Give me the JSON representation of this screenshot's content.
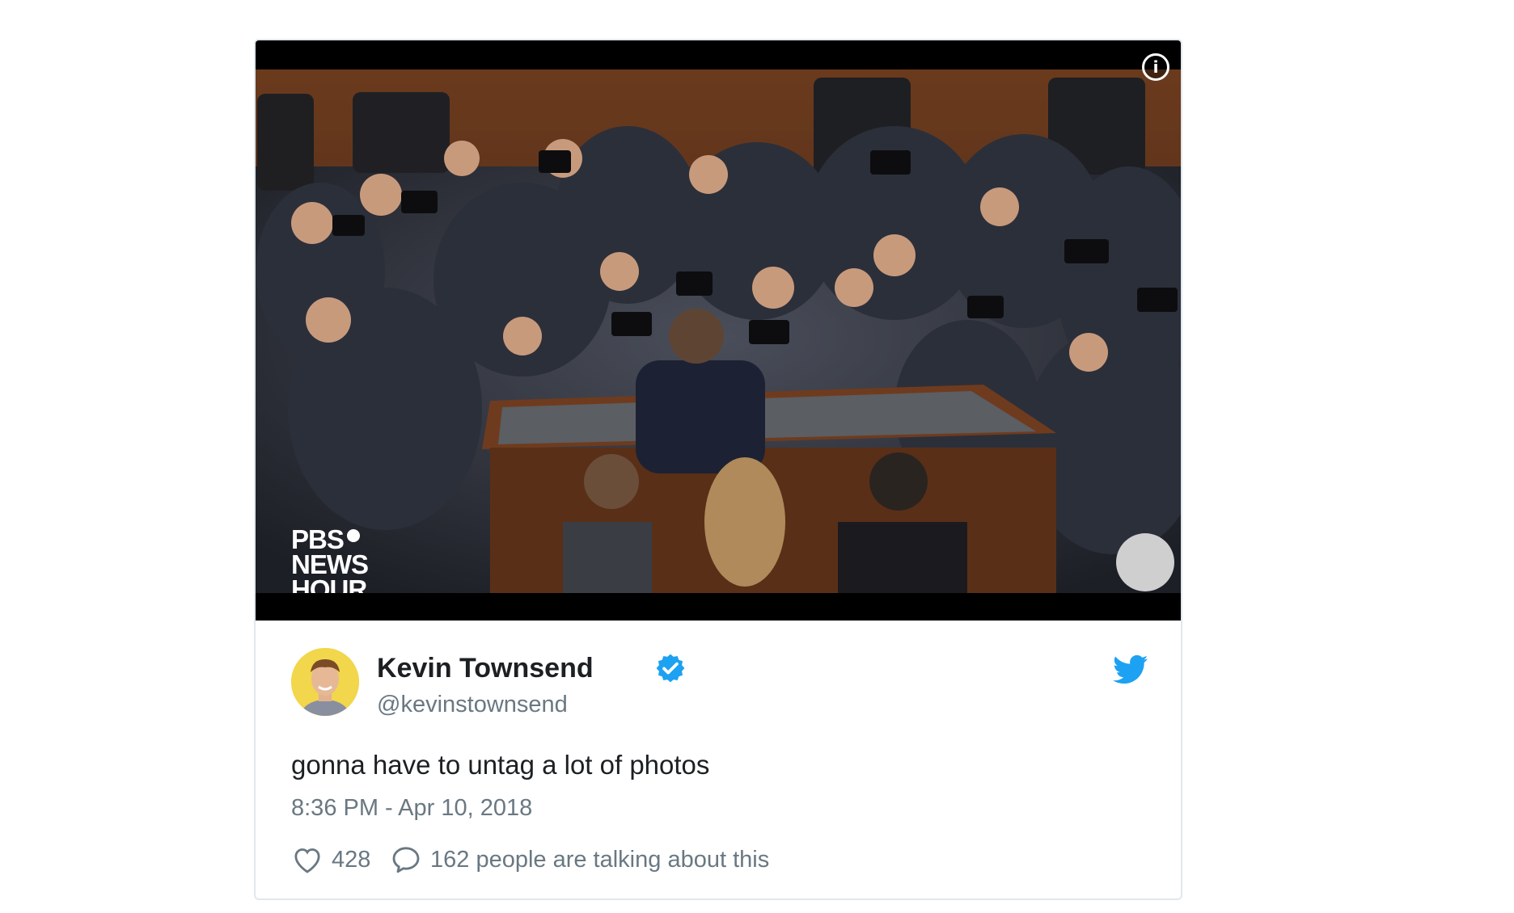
{
  "media": {
    "logo_line1": "PBS",
    "logo_line2": "NEWS",
    "logo_line3": "HOUR",
    "info_icon": "info-icon"
  },
  "author": {
    "name": "Kevin Townsend",
    "handle": "@kevinstownsend",
    "verified": true
  },
  "tweet": {
    "text": "gonna have to untag a lot of photos",
    "timestamp": "8:36 PM - Apr 10, 2018"
  },
  "actions": {
    "likes": "428",
    "talking": "162 people are talking about this"
  },
  "colors": {
    "twitter_blue": "#1da1f2",
    "verified_blue": "#1da1f2",
    "text_dark": "#1c2022",
    "text_muted": "#697882",
    "border": "#e1e8ed",
    "avatar_bg": "#f2d64b"
  },
  "icons": [
    "info-icon",
    "verified-icon",
    "twitter-bird-icon",
    "heart-icon",
    "reply-icon"
  ]
}
